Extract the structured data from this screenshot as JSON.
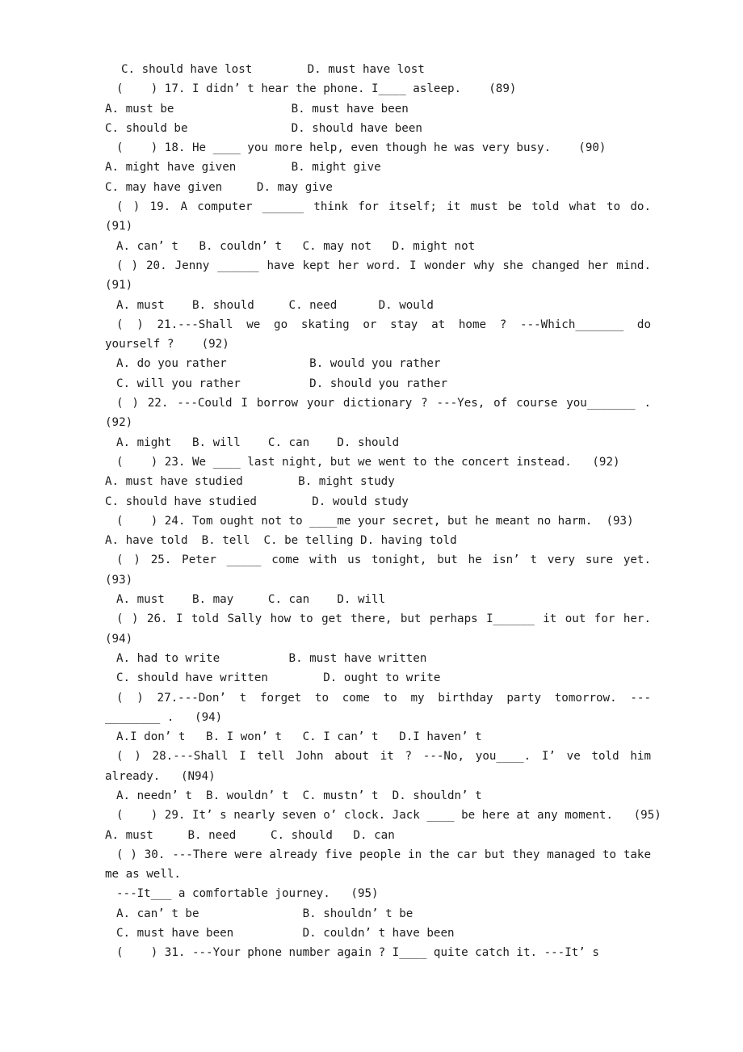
{
  "document": {
    "type": "english-grammar-worksheet",
    "topic": "modal verbs multiple choice",
    "text_color": "#1c1c1c",
    "background_color": "#ffffff",
    "lines": [
      {
        "id": "l01",
        "indent": "i2",
        "justify": false,
        "text": "C. should have lost        D. must have lost"
      },
      {
        "id": "l02",
        "indent": "i1",
        "justify": false,
        "text": "(    ) 17. I didn’ t hear the phone. I____ asleep.    (89)"
      },
      {
        "id": "l03",
        "indent": "i0",
        "justify": false,
        "text": "A. must be                 B. must have been"
      },
      {
        "id": "l04",
        "indent": "i0",
        "justify": false,
        "text": "C. should be               D. should have been"
      },
      {
        "id": "l05",
        "indent": "i1",
        "justify": false,
        "text": "(    ) 18. He ____ you more help, even though he was very busy.    (90)"
      },
      {
        "id": "l06",
        "indent": "i0",
        "justify": false,
        "text": "A. might have given        B. might give"
      },
      {
        "id": "l07",
        "indent": "i0",
        "justify": false,
        "text": "C. may have given     D. may give"
      },
      {
        "id": "l08",
        "indent": "i1",
        "justify": true,
        "text": "(      ) 19. A computer ______ think for itself; it must be told what to do."
      },
      {
        "id": "l09",
        "indent": "i0",
        "justify": false,
        "text": "(91)"
      },
      {
        "id": "l10",
        "indent": "i1",
        "justify": false,
        "text": "A. can’ t   B. couldn’ t   C. may not   D. might not"
      },
      {
        "id": "l11",
        "indent": "i1",
        "justify": true,
        "text": "(    ) 20. Jenny ______ have kept her word. I wonder why she changed her mind."
      },
      {
        "id": "l12",
        "indent": "i0",
        "justify": false,
        "text": "(91)"
      },
      {
        "id": "l13",
        "indent": "i1",
        "justify": false,
        "text": "A. must    B. should     C. need      D. would"
      },
      {
        "id": "l14",
        "indent": "i1",
        "justify": true,
        "text": "(      ) 21.---Shall we go skating or stay at home ?   ---Which_______          do"
      },
      {
        "id": "l15",
        "indent": "i0",
        "justify": false,
        "text": "yourself ?    (92)"
      },
      {
        "id": "l16",
        "indent": "i1",
        "justify": false,
        "text": "A. do you rather            B. would you rather"
      },
      {
        "id": "l17",
        "indent": "i1",
        "justify": false,
        "text": "C. will you rather          D. should you rather"
      },
      {
        "id": "l18",
        "indent": "i1",
        "justify": true,
        "text": "(    ) 22. ---Could I borrow your dictionary ?  ---Yes, of course you_______ ."
      },
      {
        "id": "l19",
        "indent": "i0",
        "justify": false,
        "text": "(92)"
      },
      {
        "id": "l20",
        "indent": "i1",
        "justify": false,
        "text": "A. might   B. will    C. can    D. should"
      },
      {
        "id": "l21",
        "indent": "i1",
        "justify": false,
        "text": "(    ) 23. We ____ last night, but we went to the concert instead.   (92)"
      },
      {
        "id": "l22",
        "indent": "i0",
        "justify": false,
        "text": "A. must have studied        B. might study"
      },
      {
        "id": "l23",
        "indent": "i0",
        "justify": false,
        "text": "C. should have studied        D. would study"
      },
      {
        "id": "l24",
        "indent": "i1",
        "justify": false,
        "text": "(    ) 24. Tom ought not to ____me your secret, but he meant no harm.  (93)"
      },
      {
        "id": "l25",
        "indent": "i0",
        "justify": false,
        "text": "A. have told  B. tell  C. be telling D. having told"
      },
      {
        "id": "l26",
        "indent": "i1",
        "justify": true,
        "text": "(      ) 25. Peter _____ come with us tonight, but he isn’ t very sure yet."
      },
      {
        "id": "l27",
        "indent": "i0",
        "justify": false,
        "text": "(93)"
      },
      {
        "id": "l28",
        "indent": "i1",
        "justify": false,
        "text": "A. must    B. may     C. can    D. will"
      },
      {
        "id": "l29",
        "indent": "i1",
        "justify": true,
        "text": "(    ) 26. I told Sally how to get there, but perhaps I______ it out for her."
      },
      {
        "id": "l30",
        "indent": "i0",
        "justify": false,
        "text": "(94)"
      },
      {
        "id": "l31",
        "indent": "i1",
        "justify": false,
        "text": "A. had to write          B. must have written"
      },
      {
        "id": "l32",
        "indent": "i1",
        "justify": false,
        "text": "C. should have written        D. ought to write"
      },
      {
        "id": "l33",
        "indent": "i1",
        "justify": true,
        "text": "(        ) 27.---Don’ t forget to come to my birthday party tomorrow.   ---"
      },
      {
        "id": "l34",
        "indent": "i0",
        "justify": false,
        "text": "________ .   (94)"
      },
      {
        "id": "l35",
        "indent": "i1",
        "justify": false,
        "text": "A.I don’ t   B. I won’ t   C. I can’ t   D.I haven’ t"
      },
      {
        "id": "l36",
        "indent": "i1",
        "justify": true,
        "text": "(    ) 28.---Shall I tell John about it ?   ---No, you____.   I’ ve told him"
      },
      {
        "id": "l37",
        "indent": "i0",
        "justify": false,
        "text": "already.   (N94)"
      },
      {
        "id": "l38",
        "indent": "i1",
        "justify": false,
        "text": "A. needn’ t  B. wouldn’ t  C. mustn’ t  D. shouldn’ t"
      },
      {
        "id": "l39",
        "indent": "i1",
        "justify": false,
        "text": "(    ) 29. It’ s nearly seven o’ clock. Jack ____ be here at any moment.   (95)"
      },
      {
        "id": "l40",
        "indent": "i0",
        "justify": false,
        "text": "A. must     B. need     C. should   D. can"
      },
      {
        "id": "l41",
        "indent": "i1",
        "justify": true,
        "text": "(    ) 30. ---There were already five people in the car but they managed to take"
      },
      {
        "id": "l42",
        "indent": "i0",
        "justify": false,
        "text": "me as well."
      },
      {
        "id": "l43",
        "indent": "i1",
        "justify": false,
        "text": "---It___ a comfortable journey.   (95)"
      },
      {
        "id": "l44",
        "indent": "i1",
        "justify": false,
        "text": "A. can’ t be               B. shouldn’ t be"
      },
      {
        "id": "l45",
        "indent": "i1",
        "justify": false,
        "text": "C. must have been          D. couldn’ t have been"
      },
      {
        "id": "l46",
        "indent": "i1",
        "justify": false,
        "text": "(    ) 31. ---Your phone number again ? I____ quite catch it. ---It’ s"
      }
    ]
  }
}
